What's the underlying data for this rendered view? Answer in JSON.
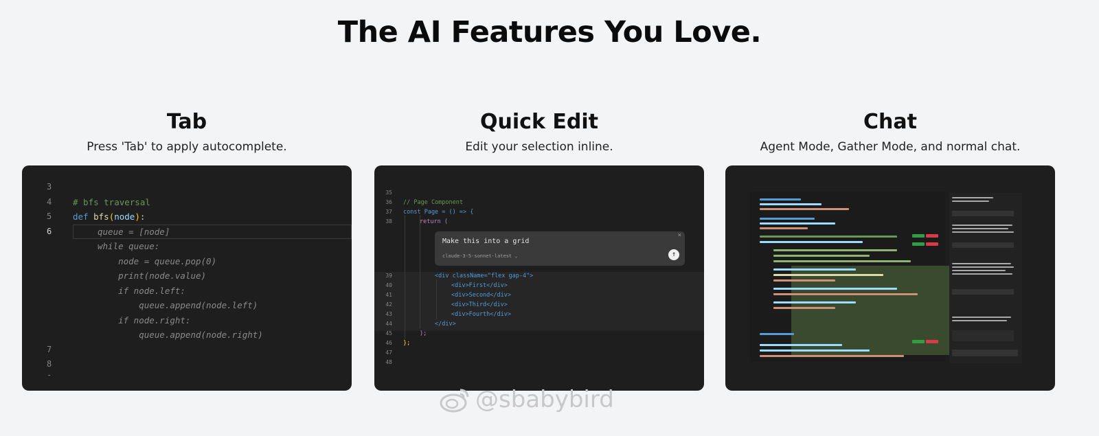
{
  "headline": "The AI Features You Love.",
  "features": [
    {
      "title": "Tab",
      "description": "Press 'Tab' to apply autocomplete.",
      "code": {
        "line_numbers": [
          "3",
          "4",
          "5",
          "6",
          "7",
          "8",
          "-"
        ],
        "comment": "# bfs traversal",
        "def_kw": "def",
        "fn_name": "bfs",
        "param": "node",
        "suggestion_lines": [
          "queue = [node]",
          "while queue:",
          "    node = queue.pop(0)",
          "    print(node.value)",
          "    if node.left:",
          "        queue.append(node.left)",
          "    if node.right:",
          "        queue.append(node.right)"
        ]
      }
    },
    {
      "title": "Quick Edit",
      "description": "Edit your selection inline.",
      "code": {
        "line_numbers_top": [
          "35",
          "36",
          "37",
          "38"
        ],
        "line_numbers_bottom": [
          "39",
          "40",
          "41",
          "42",
          "43",
          "44",
          "45",
          "46",
          "47",
          "48"
        ],
        "comment": "// Page Component",
        "const_line": "const Page = () => {",
        "return_line": "return (",
        "div_open": "<div className=\"flex gap-4\">",
        "items": [
          "<div>First</div>",
          "<div>Second</div>",
          "<div>Third</div>",
          "<div>Fourth</div>"
        ],
        "div_close": "</div>",
        "paren_close": ");",
        "brace_close": "};"
      },
      "prompt": {
        "text": "Make this into a grid",
        "model": "claude-3-5-sonnet-latest",
        "close_icon": "close-icon",
        "send_icon": "send-arrow-icon"
      }
    },
    {
      "title": "Chat",
      "description": "Agent Mode, Gather Mode, and normal chat."
    }
  ],
  "watermark": "@sbabybird"
}
